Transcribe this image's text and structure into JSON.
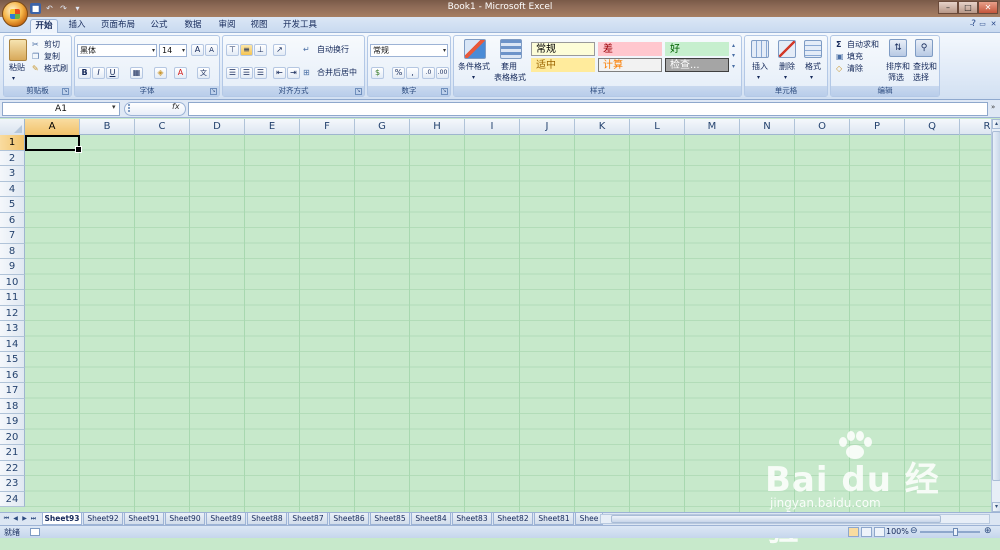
{
  "window": {
    "title": "Book1 - Microsoft Excel"
  },
  "tabs": [
    "开始",
    "插入",
    "页面布局",
    "公式",
    "数据",
    "审阅",
    "视图",
    "开发工具"
  ],
  "active_tab": "开始",
  "ribbon": {
    "clipboard": {
      "label": "剪贴板",
      "paste": "粘贴",
      "cut": "剪切",
      "copy": "复制",
      "format_painter": "格式刷"
    },
    "font": {
      "label": "字体",
      "font_name": "黑体",
      "font_size": "14"
    },
    "alignment": {
      "label": "对齐方式",
      "wrap_text": "自动换行",
      "merge_center": "合并后居中"
    },
    "number": {
      "label": "数字",
      "format": "常规"
    },
    "styles": {
      "label": "样式",
      "conditional_format": "条件格式",
      "format_as_table_line1": "套用",
      "format_as_table_line2": "表格格式",
      "cells": [
        {
          "name": "常规",
          "bg": "#fdfdd8",
          "color": "#000000",
          "border": "#9a9a9a"
        },
        {
          "name": "差",
          "bg": "#ffc7ce",
          "color": "#9c0006",
          "border": "#ffc7ce"
        },
        {
          "name": "好",
          "bg": "#c6efce",
          "color": "#006100",
          "border": "#c6efce"
        },
        {
          "name": "适中",
          "bg": "#ffeb9c",
          "color": "#9c6500",
          "border": "#ffeb9c"
        },
        {
          "name": "计算",
          "bg": "#f2f2f2",
          "color": "#fa7d00",
          "border": "#7f7f7f"
        },
        {
          "name": "检查...",
          "bg": "#a5a5a5",
          "color": "#ffffff",
          "border": "#3f3f3f"
        }
      ]
    },
    "cells_group": {
      "label": "单元格",
      "insert": "插入",
      "delete": "删除",
      "format": "格式"
    },
    "editing": {
      "label": "编辑",
      "autosum": "自动求和",
      "fill": "填充",
      "clear": "清除",
      "sort_filter_line1": "排序和",
      "sort_filter_line2": "筛选",
      "find_select_line1": "查找和",
      "find_select_line2": "选择"
    }
  },
  "formula_bar": {
    "name_box": "A1",
    "fx": "fx",
    "formula": ""
  },
  "columns": [
    "A",
    "B",
    "C",
    "D",
    "E",
    "F",
    "G",
    "H",
    "I",
    "J",
    "K",
    "L",
    "M",
    "N",
    "O",
    "P",
    "Q",
    "R"
  ],
  "rows": [
    "1",
    "2",
    "3",
    "4",
    "5",
    "6",
    "7",
    "8",
    "9",
    "10",
    "11",
    "12",
    "13",
    "14",
    "15",
    "16",
    "17",
    "18",
    "19",
    "20",
    "21",
    "22",
    "23",
    "24"
  ],
  "selected_cell": "A1",
  "sheets": [
    "Sheet93",
    "Sheet92",
    "Sheet91",
    "Sheet90",
    "Sheet89",
    "Sheet88",
    "Sheet87",
    "Sheet86",
    "Sheet85",
    "Sheet84",
    "Sheet83",
    "Sheet82",
    "Sheet81",
    "Shee"
  ],
  "active_sheet": "Sheet93",
  "status": {
    "text": "就绪",
    "zoom": "100%"
  },
  "watermark": {
    "brand": "Bai du 经验",
    "url": "jingyan.baidu.com"
  },
  "colors": {
    "grid_bg": "#c7e9cb",
    "ribbon_accent": "#dbe7f6"
  }
}
